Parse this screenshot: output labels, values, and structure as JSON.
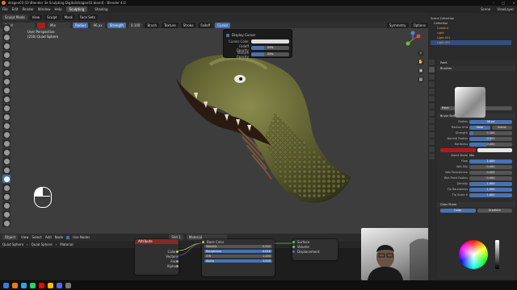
{
  "window": {
    "title": "dragon03 [D:\\Blender 3e Sculpting Digital\\dragon03.blend] - Blender 4.0"
  },
  "menu": {
    "items": [
      "File",
      "Edit",
      "Render",
      "Window",
      "Help"
    ],
    "workspaces": [
      "Sculpting",
      "Shading"
    ],
    "active_workspace": "Sculpting",
    "scene": "Scene",
    "view_layer": "ViewLayer"
  },
  "viewport_header": {
    "mode": "Sculpt Mode",
    "menus": [
      "View",
      "Sculpt",
      "Mask",
      "Face Sets"
    ],
    "brush_name": "Paint",
    "blend": "Mix",
    "radius_label": "Radius",
    "radius_value": "96 px",
    "strength_label": "Strength",
    "strength_value": "0.100",
    "brush_menu": "Brush",
    "texture_menu": "Texture",
    "stroke_menu": "Stroke",
    "falloff_menu": "Falloff",
    "cursor_menu": "Cursor",
    "symmetry": "Symmetry",
    "options": "Options"
  },
  "viewport": {
    "perspective": "User Perspective",
    "object_info": "(250) Quad Sphere"
  },
  "cursor_popover": {
    "display_cursor": "Display Cursor",
    "cursor_color_label": "Cursor Color",
    "falloff_opacity_label": "Falloff Opacity",
    "falloff_opacity_value": "33%",
    "falloff_opacity": 0.33,
    "texture_opacity_label": "Texture Opacity",
    "texture_opacity_value": "33%",
    "texture_opacity": 0.33
  },
  "node_editor": {
    "header": [
      "Object",
      "View",
      "Select",
      "Add",
      "Node",
      "Use Nodes"
    ],
    "slot": "Slot 1",
    "material": "Material",
    "breadcrumb": [
      "Quad Sphere",
      "Quad Sphere",
      "Material"
    ],
    "attribute_node": {
      "title": "Attribute",
      "outputs": [
        "Color",
        "Vector",
        "Fac",
        "Alpha"
      ]
    },
    "bsdf_node": {
      "base_color": "Base Color",
      "rows": [
        {
          "label": "Metallic",
          "value": "0.000"
        },
        {
          "label": "Roughness",
          "value": "0.618"
        },
        {
          "label": "IOR",
          "value": "1.450"
        },
        {
          "label": "Alpha",
          "value": "1.000"
        }
      ]
    },
    "output_node": {
      "rows": [
        "Surface",
        "Volume",
        "Displacement"
      ]
    }
  },
  "outliner": {
    "rows": [
      "Scene Collection",
      "Collection",
      "Camera",
      "Light",
      "Light.001",
      "Light.002"
    ]
  },
  "properties": {
    "brush_label": "Paint",
    "brushes_panel": "Brushes",
    "brush_field": "Paint",
    "settings_panel": "Brush Settings",
    "rows": [
      {
        "label": "Radius",
        "value": "96 px"
      },
      {
        "label": "Radius Unit",
        "value": "View"
      },
      {
        "label": "Strength",
        "value": "0.100"
      },
      {
        "label": "Normal Radius",
        "value": "0.500"
      },
      {
        "label": "Hardness",
        "value": "0.400"
      },
      {
        "label": "Blend Mode",
        "value": "Mix"
      },
      {
        "label": "Flow",
        "value": "1.000"
      },
      {
        "label": "Wet Mix",
        "value": "0.000"
      },
      {
        "label": "Wet Persistence",
        "value": "0.000"
      },
      {
        "label": "Wet Paint Radius",
        "value": "0.000"
      },
      {
        "label": "Density",
        "value": "1.000"
      },
      {
        "label": "Tip Roundness",
        "value": "1.000"
      },
      {
        "label": "Tip Scale X",
        "value": "1.000"
      }
    ],
    "radius_unit_alt": "Scene",
    "color_panel": "Color Picker",
    "color_tabs": [
      "Color",
      "Gradient"
    ]
  },
  "colors": {
    "accent": "#4772b3",
    "brush_color": "#b01a1a",
    "header": "#2b2b2b",
    "viewport": "#3d3d3d"
  }
}
